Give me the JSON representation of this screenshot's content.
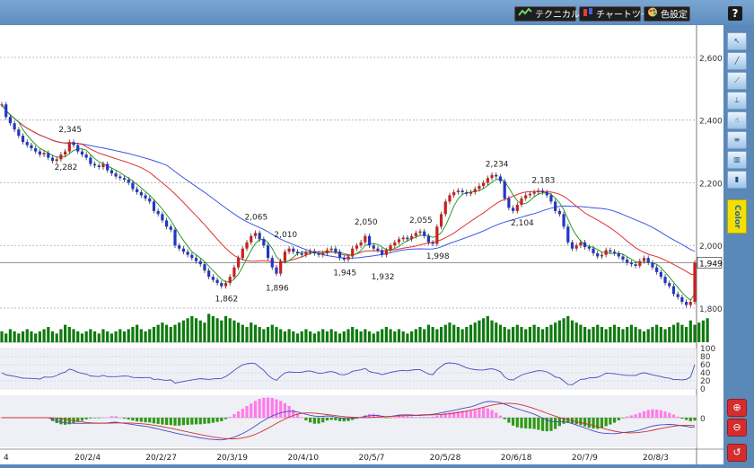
{
  "toolbar": {
    "technical_label": "テクニカル",
    "chart_tool_label": "チャートツール",
    "color_settings_label": "色設定",
    "help_label": "?"
  },
  "side_tools": {
    "color_label": "Color",
    "zoom_in_icon": "zoom-in-icon",
    "zoom_out_icon": "zoom-out-icon"
  },
  "colors": {
    "up_candle": "#cc1f1f",
    "down_candle": "#2236c8",
    "ma_short": "#2a9b2a",
    "ma_mid": "#e03030",
    "ma_long": "#3a55e6",
    "volume": "#0f7a0f",
    "macd_pos": "#ff7be8",
    "macd_neg": "#2f9a14"
  },
  "chart_data": {
    "type": "candlestick",
    "price_axis": {
      "ticks": [
        "2,600",
        "2,400",
        "2,200",
        "2,000",
        "1,800"
      ],
      "range": [
        1780,
        2680
      ]
    },
    "current_price_label": "1,949",
    "x_tick_labels": [
      "4",
      "20/2/4",
      "20/2/27",
      "20/3/19",
      "20/4/10",
      "20/5/7",
      "20/5/28",
      "20/6/18",
      "20/7/9",
      "20/8/3"
    ],
    "annotations": [
      {
        "text": "2,345",
        "idx": 16,
        "value": 2345,
        "pos": "above"
      },
      {
        "text": "2,282",
        "idx": 15,
        "value": 2282,
        "pos": "below"
      },
      {
        "text": "2,065",
        "idx": 60,
        "value": 2065,
        "pos": "above"
      },
      {
        "text": "1,862",
        "idx": 53,
        "value": 1862,
        "pos": "below"
      },
      {
        "text": "2,010",
        "idx": 67,
        "value": 2010,
        "pos": "above"
      },
      {
        "text": "1,896",
        "idx": 65,
        "value": 1896,
        "pos": "below"
      },
      {
        "text": "2,050",
        "idx": 86,
        "value": 2050,
        "pos": "above"
      },
      {
        "text": "1,945",
        "idx": 81,
        "value": 1945,
        "pos": "below"
      },
      {
        "text": "1,932",
        "idx": 90,
        "value": 1932,
        "pos": "below"
      },
      {
        "text": "2,055",
        "idx": 99,
        "value": 2055,
        "pos": "above"
      },
      {
        "text": "1,998",
        "idx": 103,
        "value": 1998,
        "pos": "below"
      },
      {
        "text": "2,234",
        "idx": 117,
        "value": 2234,
        "pos": "above"
      },
      {
        "text": "2,104",
        "idx": 123,
        "value": 2104,
        "pos": "below"
      },
      {
        "text": "2,183",
        "idx": 128,
        "value": 2183,
        "pos": "above"
      }
    ],
    "closes": [
      2450,
      2410,
      2390,
      2370,
      2350,
      2330,
      2320,
      2310,
      2300,
      2290,
      2295,
      2280,
      2270,
      2275,
      2290,
      2300,
      2330,
      2320,
      2300,
      2290,
      2280,
      2260,
      2255,
      2250,
      2260,
      2240,
      2230,
      2220,
      2215,
      2210,
      2200,
      2180,
      2170,
      2160,
      2150,
      2140,
      2110,
      2100,
      2080,
      2060,
      2050,
      2000,
      1990,
      1980,
      1970,
      1960,
      1950,
      1940,
      1920,
      1900,
      1890,
      1880,
      1870,
      1880,
      1900,
      1930,
      1960,
      1990,
      2010,
      2030,
      2040,
      2020,
      2000,
      1960,
      1930,
      1910,
      1950,
      1980,
      1990,
      1980,
      1975,
      1970,
      1978,
      1982,
      1975,
      1970,
      1975,
      1985,
      1990,
      1980,
      1960,
      1955,
      1965,
      1990,
      2000,
      2010,
      2030,
      2000,
      1990,
      1985,
      1970,
      1985,
      2000,
      2010,
      2020,
      2025,
      2020,
      2030,
      2040,
      2045,
      2030,
      2010,
      2005,
      2060,
      2100,
      2140,
      2160,
      2170,
      2175,
      2170,
      2165,
      2170,
      2180,
      2190,
      2200,
      2215,
      2225,
      2220,
      2205,
      2150,
      2120,
      2110,
      2130,
      2150,
      2160,
      2165,
      2170,
      2175,
      2170,
      2160,
      2140,
      2110,
      2100,
      2060,
      2010,
      1990,
      2000,
      2010,
      1995,
      1990,
      1975,
      1965,
      1970,
      1985,
      1980,
      1975,
      1965,
      1955,
      1945,
      1940,
      1935,
      1950,
      1960,
      1945,
      1930,
      1915,
      1900,
      1880,
      1870,
      1845,
      1835,
      1820,
      1810,
      1820,
      1945
    ],
    "volume": [
      5,
      4,
      6,
      5,
      4,
      5,
      6,
      5,
      4,
      5,
      6,
      7,
      5,
      4,
      6,
      8,
      7,
      6,
      5,
      4,
      5,
      6,
      5,
      4,
      6,
      5,
      4,
      5,
      6,
      5,
      6,
      7,
      8,
      6,
      5,
      6,
      7,
      8,
      9,
      8,
      7,
      8,
      9,
      10,
      11,
      12,
      11,
      10,
      9,
      13,
      12,
      11,
      10,
      12,
      11,
      10,
      9,
      8,
      7,
      9,
      8,
      7,
      6,
      7,
      8,
      7,
      6,
      5,
      6,
      5,
      4,
      5,
      6,
      5,
      4,
      5,
      6,
      5,
      6,
      5,
      4,
      5,
      6,
      7,
      6,
      5,
      6,
      5,
      4,
      5,
      6,
      7,
      6,
      5,
      6,
      5,
      4,
      5,
      6,
      7,
      6,
      8,
      7,
      6,
      7,
      8,
      9,
      8,
      7,
      6,
      7,
      8,
      9,
      10,
      11,
      12,
      10,
      9,
      8,
      7,
      6,
      7,
      8,
      7,
      6,
      7,
      8,
      7,
      6,
      7,
      8,
      9,
      10,
      11,
      12,
      10,
      9,
      8,
      7,
      6,
      7,
      8,
      7,
      6,
      7,
      8,
      7,
      6,
      7,
      8,
      7,
      6,
      5,
      6,
      7,
      8,
      7,
      6,
      7,
      8,
      9,
      8,
      7,
      10,
      8,
      9,
      10,
      11
    ],
    "volume_max": 14,
    "oscillator": {
      "ticks": [
        "100",
        "80",
        "60",
        "40",
        "20",
        "0"
      ],
      "range": [
        0,
        100
      ]
    },
    "macd_axis": {
      "ticks": [
        "0"
      ]
    }
  }
}
